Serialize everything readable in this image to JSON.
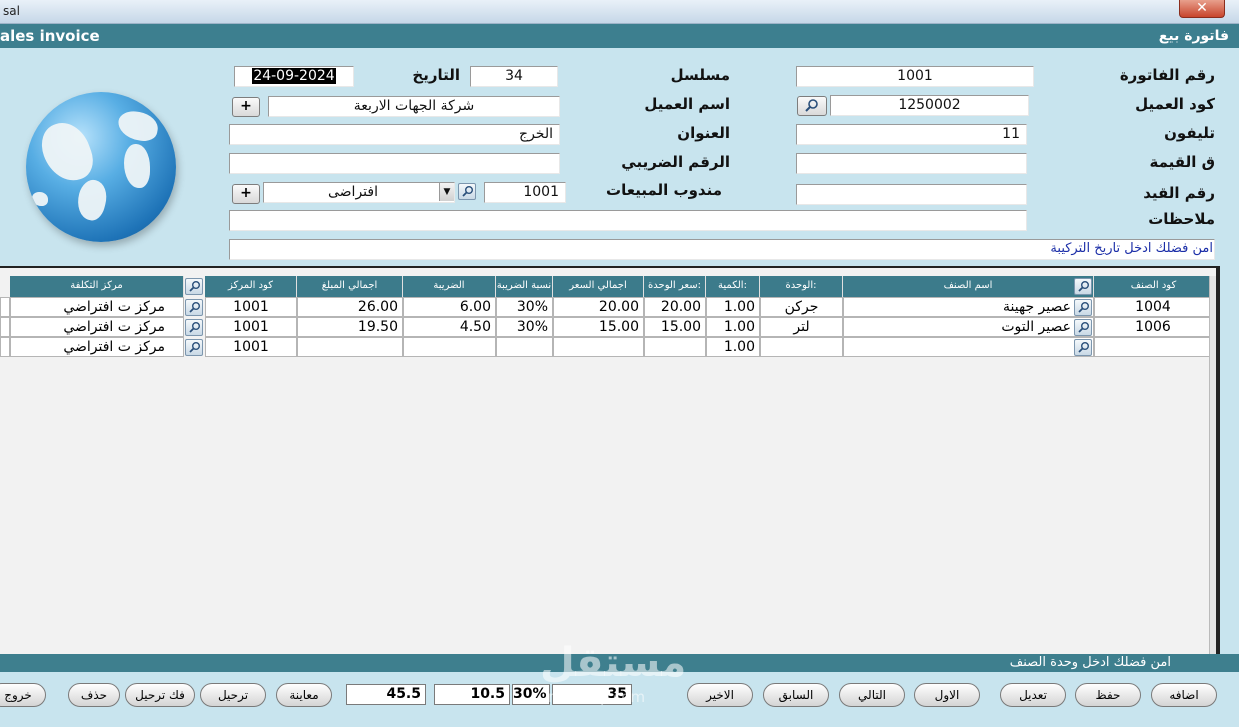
{
  "window": {
    "title": "sal",
    "close": "✕"
  },
  "header": {
    "title_en": "ales invoice",
    "title_ar": "فاتورة بيع"
  },
  "form": {
    "invoice_no": {
      "label": "رقم الفاتورة",
      "value": "1001"
    },
    "serial": {
      "label": "مسلسل",
      "value": "34"
    },
    "date": {
      "label": "التاريخ",
      "value": "24-09-2024"
    },
    "customer_code": {
      "label": "كود العميل",
      "value": "1250002"
    },
    "customer_name": {
      "label": "اسم العميل",
      "value": "شركة الجهات الاربعة"
    },
    "phone": {
      "label": "تليفون",
      "value": "11"
    },
    "address": {
      "label": "العنوان",
      "value": "الخرج"
    },
    "value_field": {
      "label": "ق القيمة",
      "value": ""
    },
    "tax_no": {
      "label": "الرقم الضريبي",
      "value": ""
    },
    "entry_no": {
      "label": "رقم القيد",
      "value": ""
    },
    "sales_rep": {
      "label": "مندوب المبيعات",
      "code": "1001",
      "name": "افتراضى"
    },
    "notes": {
      "label": "ملاحظات",
      "value": ""
    },
    "plus": "+",
    "hint": "امن فضلك ادخل   تاريخ التركيبة"
  },
  "grid": {
    "columns": [
      "كود الصنف",
      "اسم الصنف",
      "الوحدة:",
      "الكمية:",
      "سعر الوحدة:",
      "اجمالي السعر",
      "نسبة الضريبة",
      "الضريبة",
      "اجمالي المبلغ",
      "كود المركز",
      "مركز التكلفة"
    ],
    "rows": [
      {
        "code": "1004",
        "name": "عصير جهينة",
        "unit": "جركن",
        "qty": "1.00",
        "price": "20.00",
        "total": "20.00",
        "tax_rate": "30%",
        "tax": "6.00",
        "amount": "26.00",
        "center_code": "1001",
        "center": "مركز ت افتراضي"
      },
      {
        "code": "1006",
        "name": "عصير التوت",
        "unit": "لتر",
        "qty": "1.00",
        "price": "15.00",
        "total": "15.00",
        "tax_rate": "30%",
        "tax": "4.50",
        "amount": "19.50",
        "center_code": "1001",
        "center": "مركز ت افتراضي"
      },
      {
        "code": "",
        "name": "",
        "unit": "",
        "qty": "1.00",
        "price": "",
        "total": "",
        "tax_rate": "",
        "tax": "",
        "amount": "",
        "center_code": "1001",
        "center": "مركز ت افتراضي"
      }
    ]
  },
  "footer_hint": "امن فضلك ادخل   وحدة الصنف",
  "totals": {
    "qty": "35",
    "tax_rate": "30%",
    "tax": "10.5",
    "amount": "45.5"
  },
  "buttons": {
    "add": "اضافه",
    "save": "حفظ",
    "edit": "تعديل",
    "first": "الاول",
    "next": "التالي",
    "prev": "السابق",
    "last": "الاخير",
    "preview": "معاينة",
    "post": "ترحيل",
    "unpost": "فك ترحيل",
    "delete": "حذف",
    "exit": "خروج"
  },
  "watermark": {
    "ar": "مستقل",
    "en": "mostaql.com"
  }
}
